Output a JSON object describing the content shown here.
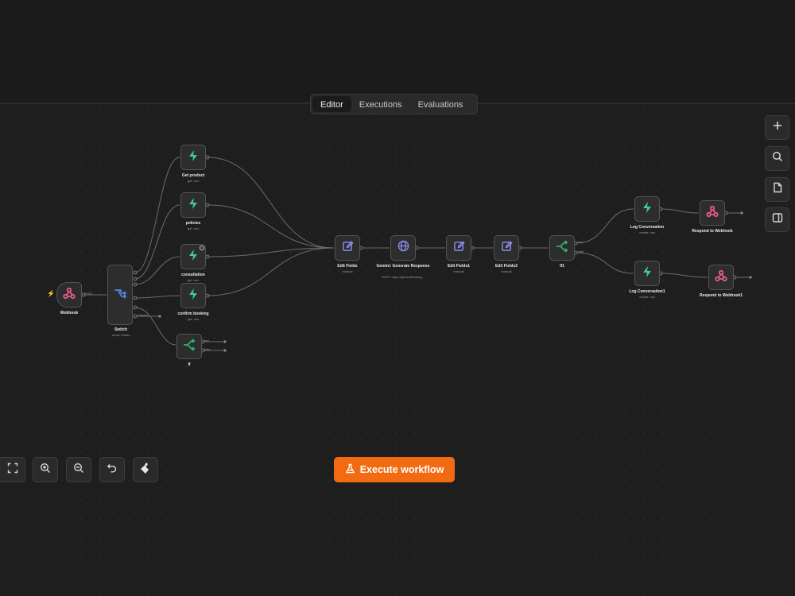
{
  "tabs": [
    {
      "label": "Editor",
      "active": true
    },
    {
      "label": "Executions",
      "active": false
    },
    {
      "label": "Evaluations",
      "active": false
    }
  ],
  "nodes": {
    "webhook": {
      "label": "Webhook",
      "icon": "webhook-icon",
      "output": "POST"
    },
    "switch": {
      "label": "Switch",
      "sub": "mode: Rules",
      "icon": "switch-icon",
      "fallback": "Fallback"
    },
    "get_product": {
      "label": "Get product",
      "sub": "get: row",
      "icon": "supabase-icon"
    },
    "policies": {
      "label": "policies",
      "sub": "get: row",
      "icon": "supabase-icon"
    },
    "consultation": {
      "label": "consultation",
      "sub": "get: row",
      "icon": "supabase-icon"
    },
    "confirm_booking": {
      "label": "confirm booking",
      "sub": "get: row",
      "icon": "supabase-icon"
    },
    "if": {
      "label": "If",
      "icon": "if-icon",
      "true": "true",
      "false": "false"
    },
    "edit_fields": {
      "label": "Edit Fields",
      "sub": "manual",
      "icon": "pencil-icon"
    },
    "gemini": {
      "label": "Gemini: Generate Response",
      "sub": "POST: https://generativelang...",
      "icon": "globe-icon"
    },
    "edit_fields1": {
      "label": "Edit Fields1",
      "sub": "manual",
      "icon": "pencil-icon"
    },
    "edit_fields2": {
      "label": "Edit Fields2",
      "sub": "manual",
      "icon": "pencil-icon"
    },
    "if1": {
      "label": "If1",
      "icon": "if-icon",
      "true": "true",
      "false": "false"
    },
    "log_conversation": {
      "label": "Log Conversation",
      "sub": "create: row",
      "icon": "supabase-icon"
    },
    "log_conversation1": {
      "label": "Log Conversation1",
      "sub": "create: row",
      "icon": "supabase-icon"
    },
    "respond": {
      "label": "Respond to Webhook",
      "icon": "webhook-icon"
    },
    "respond1": {
      "label": "Respond to Webhook1",
      "icon": "webhook-icon"
    }
  },
  "right_toolbar": [
    "plus-icon",
    "search-icon",
    "sticky-note-icon",
    "panel-icon"
  ],
  "canvas_controls": [
    "fit-view-icon",
    "zoom-in-icon",
    "zoom-out-icon",
    "undo-icon",
    "tidy-up-icon"
  ],
  "execute_button": {
    "label": "Execute workflow",
    "icon": "flask-icon"
  },
  "colors": {
    "accent": "#f26a12",
    "supabase": "#3ecf8e",
    "webhook": "#e85a8a",
    "switch": "#4f8fe6",
    "edit": "#8f8cf5",
    "if": "#2fb26f"
  }
}
